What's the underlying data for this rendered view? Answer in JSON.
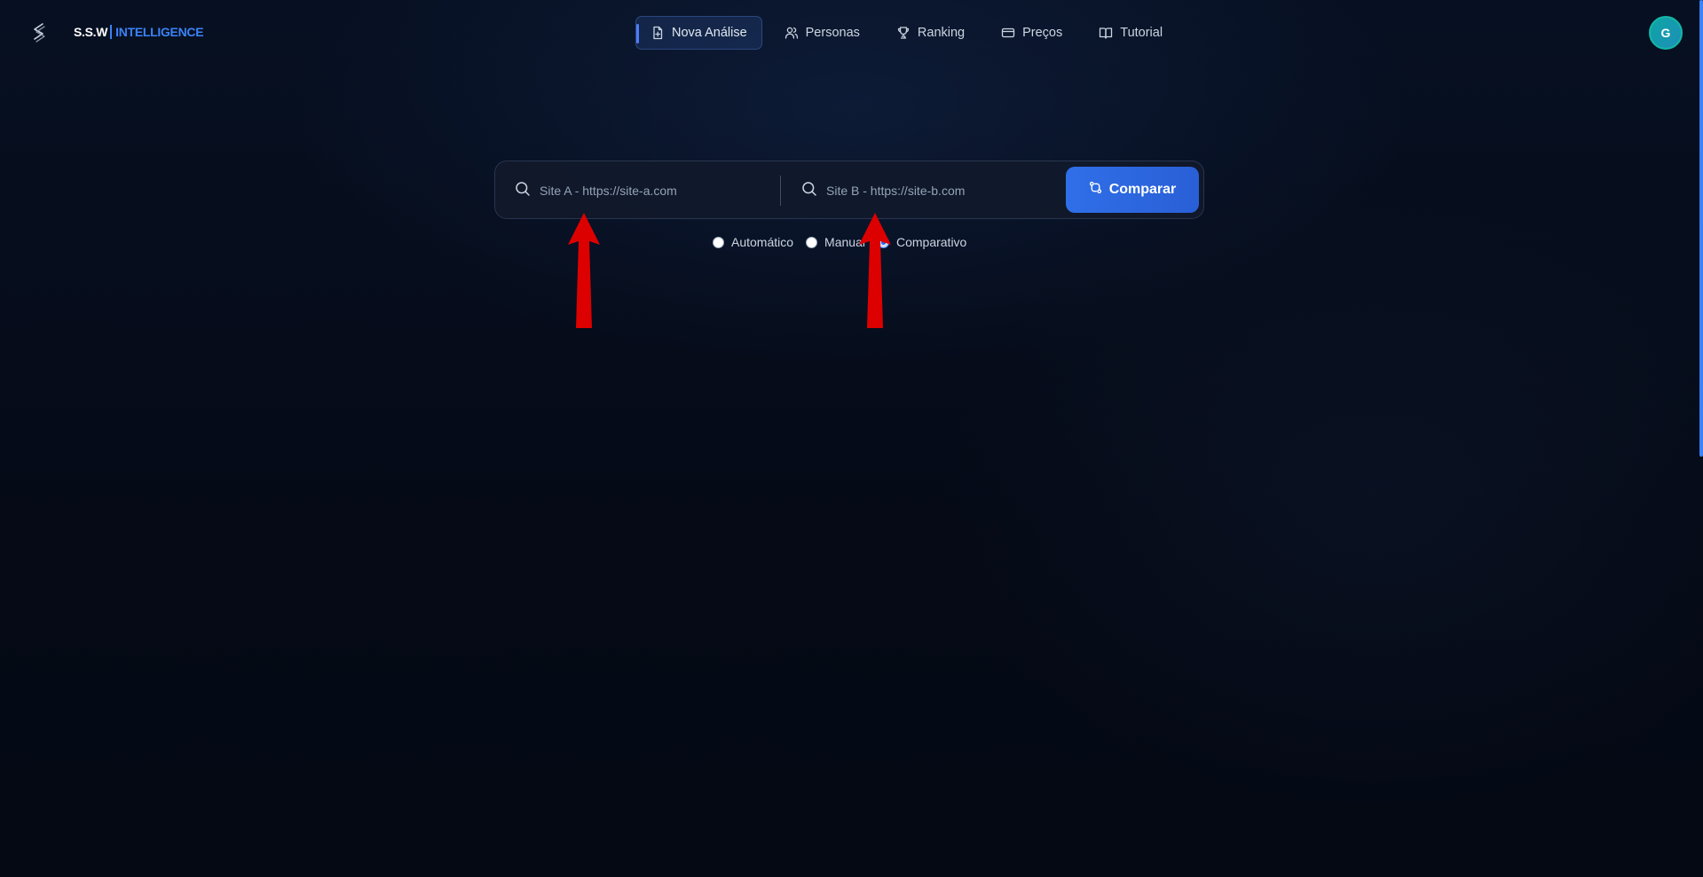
{
  "brand": {
    "name_primary": "S.S.W",
    "name_secondary": "INTELLIGENCE",
    "accent": "#3b82f6"
  },
  "nav": {
    "items": [
      {
        "label": "Nova Análise",
        "icon": "document-icon",
        "active": true
      },
      {
        "label": "Personas",
        "icon": "users-icon",
        "active": false
      },
      {
        "label": "Ranking",
        "icon": "trophy-icon",
        "active": false
      },
      {
        "label": "Preços",
        "icon": "credit-card-icon",
        "active": false
      },
      {
        "label": "Tutorial",
        "icon": "book-open-icon",
        "active": false
      }
    ]
  },
  "user": {
    "avatar_initial": "G",
    "avatar_color": "#0ea5a5"
  },
  "search": {
    "site_a": {
      "value": "",
      "placeholder": "Site A - https://site-a.com"
    },
    "site_b": {
      "value": "",
      "placeholder": "Site B - https://site-b.com"
    },
    "compare_label": "Comparar",
    "button_color": "#2f6fe8"
  },
  "modes": {
    "options": [
      {
        "label": "Automático",
        "checked": false
      },
      {
        "label": "Manual",
        "checked": false
      },
      {
        "label": "Comparativo",
        "checked": true
      }
    ],
    "selected": "Comparativo"
  },
  "annotations": {
    "arrow_color": "#dd0000",
    "arrow_count": 2
  }
}
